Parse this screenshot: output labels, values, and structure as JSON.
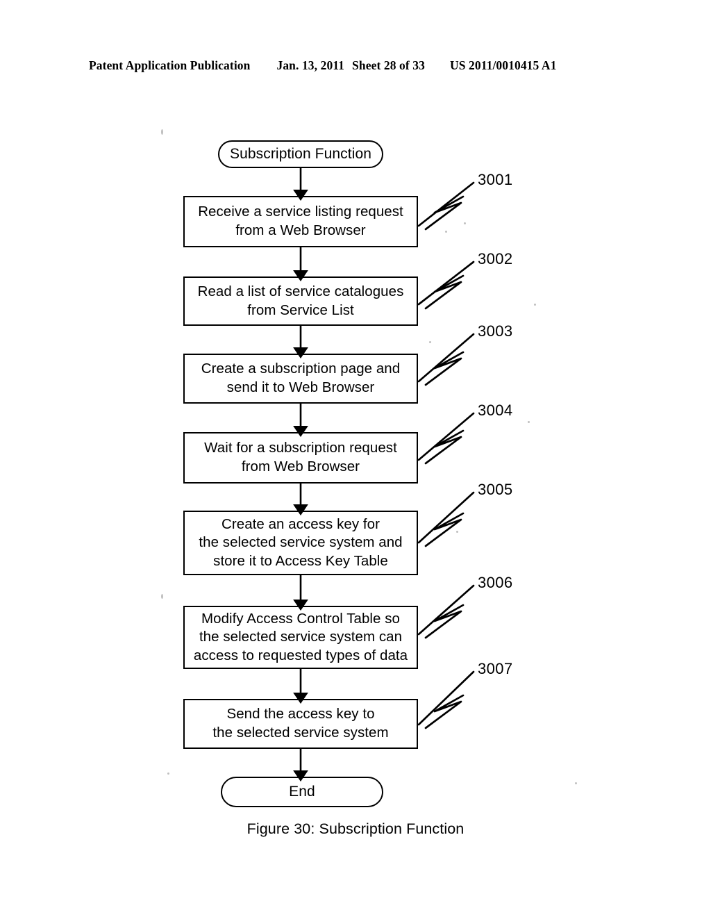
{
  "header": {
    "publication": "Patent Application Publication",
    "date": "Jan. 13, 2011",
    "sheet": "Sheet 28 of 33",
    "patent_number": "US 2011/0010415 A1"
  },
  "figure": {
    "caption": "Figure 30: Subscription Function",
    "title": "Subscription Function",
    "number": "30"
  },
  "flowchart": {
    "start": {
      "label": "Subscription Function"
    },
    "end": {
      "label": "End"
    },
    "steps": [
      {
        "ref": "3001",
        "label": "Receive a service listing request\nfrom a Web Browser"
      },
      {
        "ref": "3002",
        "label": "Read a list of service catalogues\nfrom Service List"
      },
      {
        "ref": "3003",
        "label": "Create a subscription page and\nsend it to Web Browser"
      },
      {
        "ref": "3004",
        "label": "Wait for a subscription request\nfrom Web Browser"
      },
      {
        "ref": "3005",
        "label": "Create an access key for\nthe selected service system and\nstore it to Access Key Table"
      },
      {
        "ref": "3006",
        "label": "Modify Access Control Table so\nthe selected service system can\naccess to requested types of data"
      },
      {
        "ref": "3007",
        "label": "Send the access key to\nthe selected service system"
      }
    ]
  },
  "style": {
    "ink": "#000000",
    "paper": "#ffffff"
  }
}
